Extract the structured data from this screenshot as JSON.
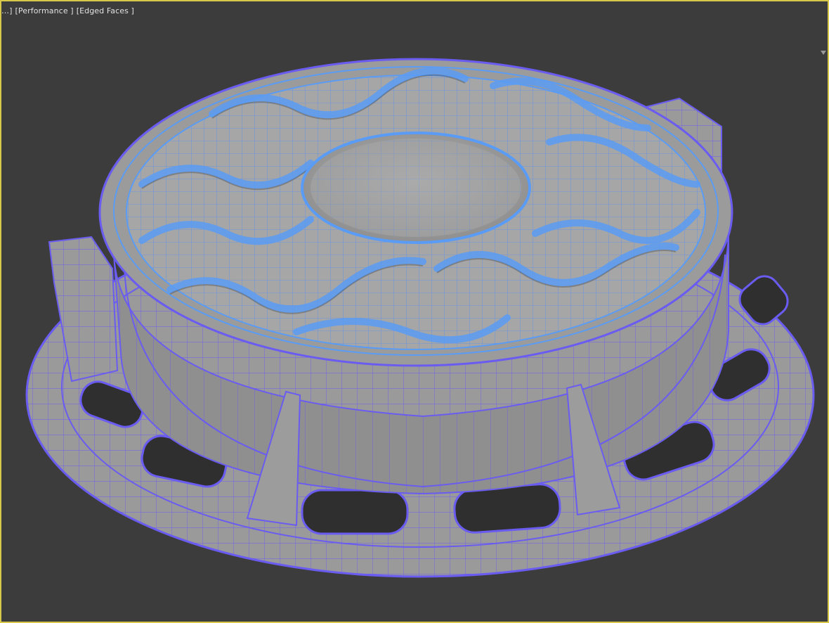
{
  "viewport": {
    "labels": [
      "…]",
      "[Performance ]",
      "[Edged Faces ]"
    ],
    "active_border_color": "#d8c84a",
    "background_color": "#3c3c3c"
  },
  "model": {
    "description_icon": "manhole-cover-mesh",
    "edge_color_outer": "#6a5cf0",
    "edge_color_top": "#5a9cf5",
    "surface_color": "#a3a3a3"
  }
}
